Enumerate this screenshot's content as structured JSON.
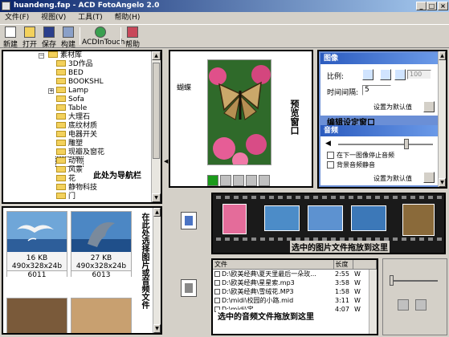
{
  "window": {
    "filename": "huandeng.fap",
    "app": "ACD FotoAngelo 2.0",
    "title": "huandeng.fap - ACD FotoAngelo 2.0"
  },
  "menu": {
    "file": "文件(F)",
    "view": "视图(V)",
    "tools": "工具(T)",
    "help": "帮助(H)"
  },
  "toolbar": {
    "new": "新建",
    "open": "打开",
    "save": "保存",
    "build": "构建",
    "acdintouch": "ACDInTouch",
    "help": "帮助"
  },
  "tree": {
    "root": "素材库",
    "items": [
      "3D作品",
      "BED",
      "BOOKSHL",
      "Lamp",
      "Sofa",
      "Table",
      "大理石",
      "底纹材质",
      "电器开关",
      "雕塑",
      "现瓣及窗花",
      "动物",
      "风景",
      "花",
      "静物科技",
      "门"
    ],
    "annotation": "此处为导航栏"
  },
  "preview": {
    "image_label": "蝴蝶",
    "annotation": "预览窗口"
  },
  "settings": {
    "image_header": "图像",
    "ratio_label": "比例:",
    "interval_label": "时间间隔:",
    "interval_value": "5",
    "spinner_value": "100",
    "set_default": "设置为默认值",
    "annotation": "编辑设定窗口",
    "audio_header": "音频",
    "audio_stop": "在下一图像停止音频",
    "audio_mute": "背景音频静音",
    "audio_set_default": "设置为默认值"
  },
  "thumbnails": {
    "items": [
      {
        "size": "16 KB",
        "dims": "490x328x24b",
        "name": "6011"
      },
      {
        "size": "27 KB",
        "dims": "490x328x24b",
        "name": "6013"
      }
    ],
    "annotation": "在此处选择图片或音频文件"
  },
  "filmstrip": {
    "annotation": "选中的图片文件拖放到这里"
  },
  "audio": {
    "headers": {
      "file": "文件",
      "length": "长度"
    },
    "rows": [
      {
        "file": "D:\\欧美经典\\夏天里最后一朵玫...",
        "length": "2:55",
        "flag": "W"
      },
      {
        "file": "D:\\欧美经典\\星星索.mp3",
        "length": "3:58",
        "flag": "W"
      },
      {
        "file": "D:\\欧美经典\\雪绒花.MP3",
        "length": "1:58",
        "flag": "W"
      },
      {
        "file": "D:\\midi\\校园的小路.mid",
        "length": "3:11",
        "flag": "W"
      },
      {
        "file": "D:\\midi\\宝...",
        "length": "4:07",
        "flag": "W"
      }
    ],
    "annotation": "选中的音频文件拖放到这里"
  },
  "colors": {
    "title_start": "#0a246a",
    "title_end": "#a6caf0",
    "panel_header": "#2b5bbf",
    "chrome": "#d4d0c8",
    "play_green": "#1a9a1a"
  }
}
